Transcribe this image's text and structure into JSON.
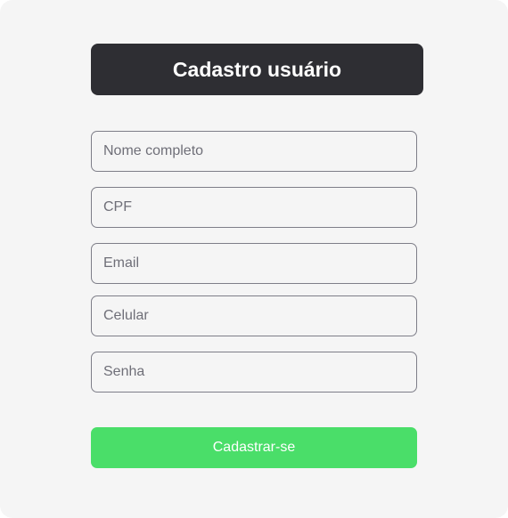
{
  "header": {
    "title": "Cadastro usuário"
  },
  "form": {
    "fields": [
      {
        "placeholder": "Nome completo",
        "value": ""
      },
      {
        "placeholder": "CPF",
        "value": ""
      },
      {
        "placeholder": "Email",
        "value": ""
      },
      {
        "placeholder": "Celular",
        "value": ""
      },
      {
        "placeholder": "Senha",
        "value": ""
      }
    ],
    "submit_label": "Cadastrar-se"
  },
  "colors": {
    "background": "#f5f5f5",
    "header_bg": "#2e2e33",
    "button_bg": "#4ade69",
    "field_border": "#7e7e88"
  }
}
